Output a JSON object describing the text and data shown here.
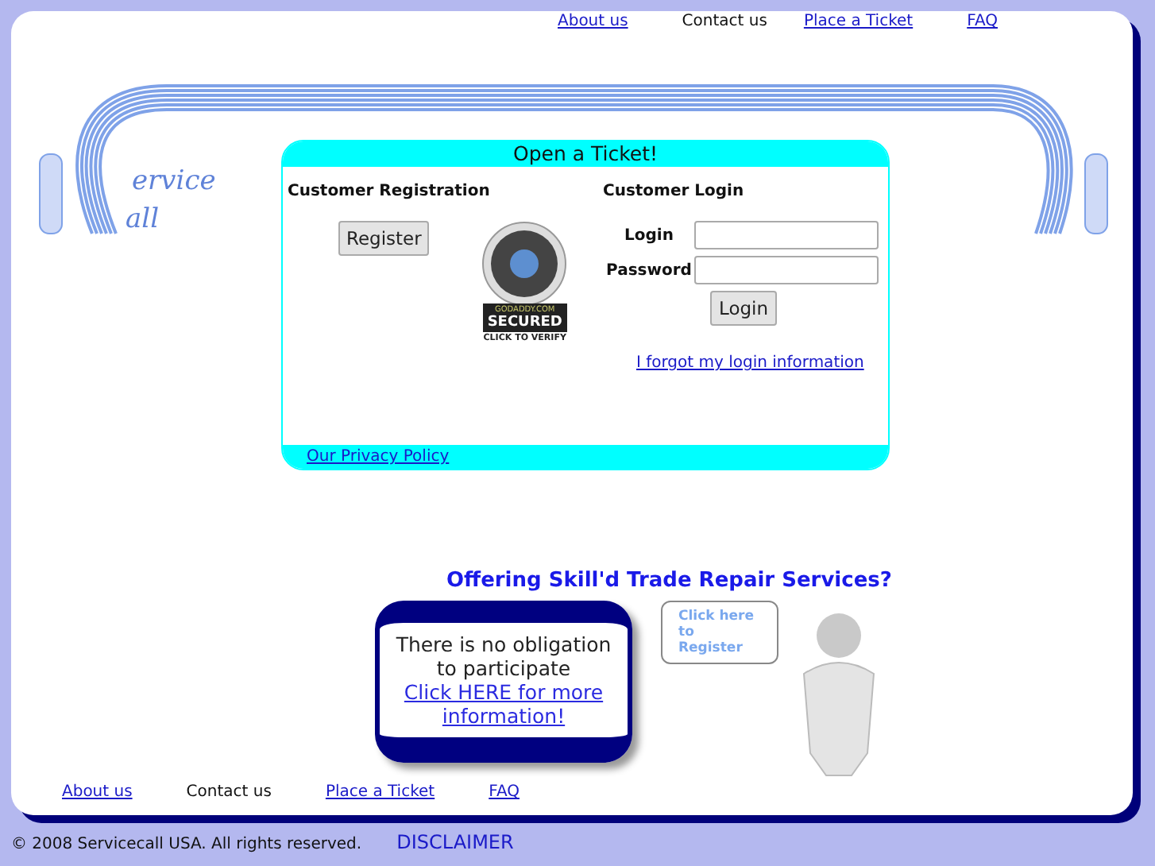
{
  "top_nav": [
    {
      "label": "About us",
      "link": true
    },
    {
      "label": "Contact us",
      "link": false
    },
    {
      "label": "Place a Ticket",
      "link": true
    },
    {
      "label": "FAQ",
      "link": true
    }
  ],
  "logo": {
    "line_1": "ervice",
    "line_2": "all"
  },
  "ticket_box": {
    "title": "Open a Ticket!",
    "registration": {
      "heading": "Customer Registration",
      "button": "Register",
      "seal": {
        "top": "GODADDY.COM",
        "badge": "SECURED",
        "caption": "CLICK TO VERIFY"
      }
    },
    "login": {
      "heading": "Customer Login",
      "fields": [
        {
          "label": "Login"
        },
        {
          "label": "Password"
        }
      ],
      "button": "Login",
      "forgot_link": "I forgot my login information"
    },
    "footer_link": "Our Privacy Policy"
  },
  "promo": {
    "heading": "Offering Skill'd Trade Repair Services?",
    "notice": "There is no obligation to participate",
    "notice_link": "Click HERE for more information!",
    "bubble": "Click here to Register"
  },
  "bottom_nav": [
    {
      "label": "About us",
      "link": true
    },
    {
      "label": "Contact us",
      "link": false
    },
    {
      "label": "Place a Ticket",
      "link": true
    },
    {
      "label": "FAQ",
      "link": true
    }
  ],
  "footer": {
    "copyright": "© 2008 Servicecall USA. All rights reserved.",
    "disclaimer": "DISCLAIMER"
  }
}
